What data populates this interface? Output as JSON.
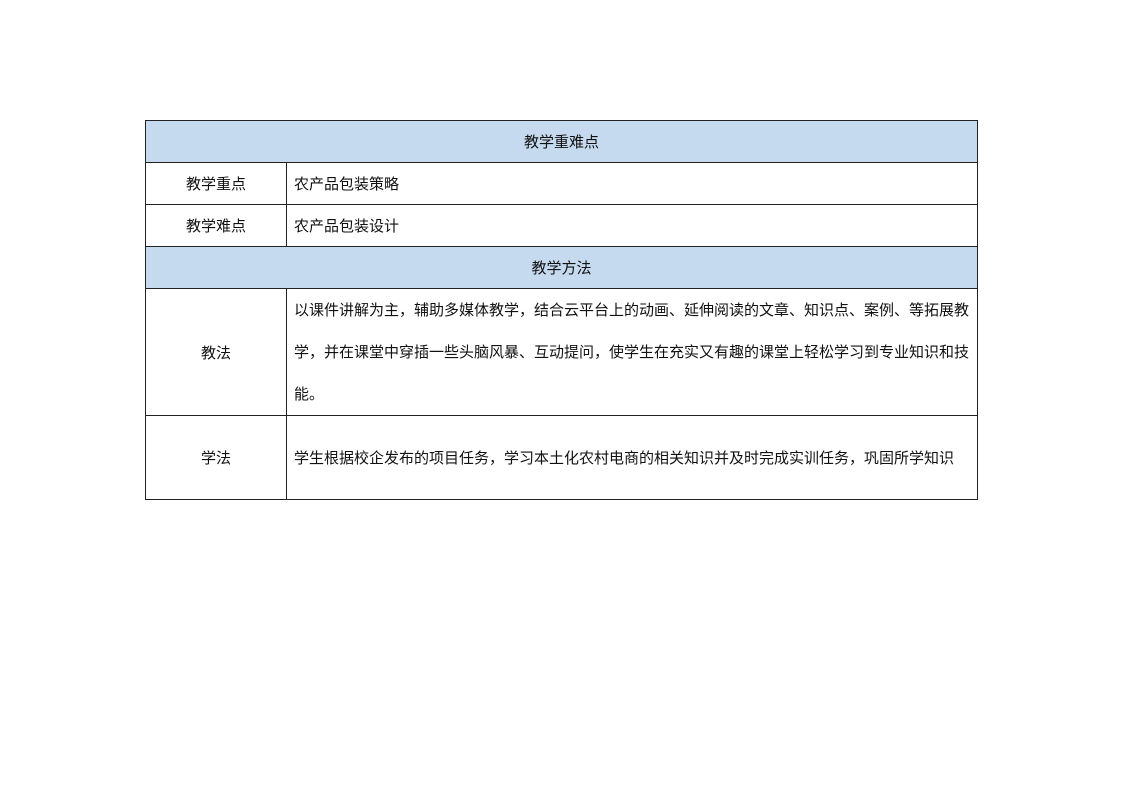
{
  "sections": {
    "key_points_header": "教学重难点",
    "methods_header": "教学方法"
  },
  "rows": {
    "focus": {
      "label": "教学重点",
      "value": "农产品包装策略"
    },
    "difficulty": {
      "label": "教学难点",
      "value": "农产品包装设计"
    },
    "teaching_method": {
      "label": "教法",
      "value": "以课件讲解为主，辅助多媒体教学，结合云平台上的动画、延伸阅读的文章、知识点、案例、等拓展教学，并在课堂中穿插一些头脑风暴、互动提问，使学生在充实又有趣的课堂上轻松学习到专业知识和技能。"
    },
    "study_method": {
      "label": "学法",
      "value": "学生根据校企发布的项目任务，学习本土化农村电商的相关知识并及时完成实训任务，巩固所学知识"
    }
  }
}
